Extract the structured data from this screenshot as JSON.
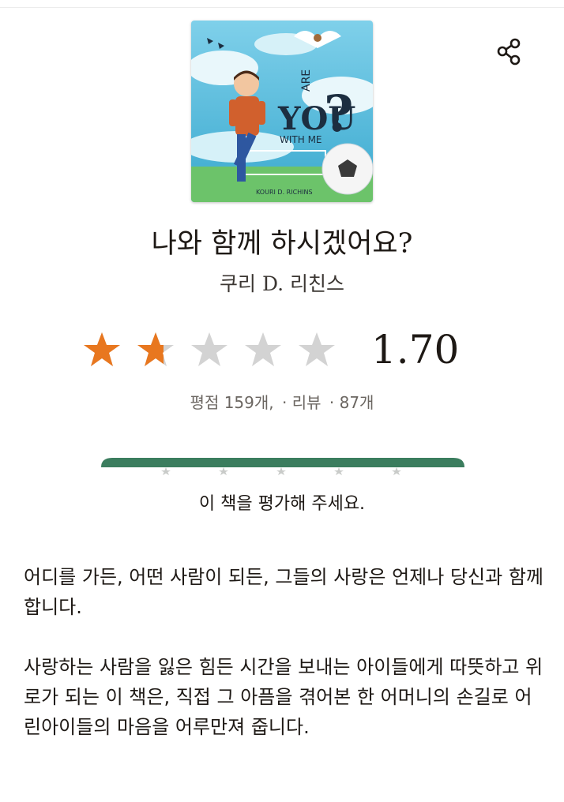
{
  "book": {
    "title": "나와 함께 하시겠어요?",
    "author": "쿠리 D. 리친스",
    "cover": {
      "title_line1": "ARE",
      "title_line2": "YOU",
      "title_line3": "WITH ME",
      "question_mark": "?",
      "author_on_cover": "KOURI D. RICHINS"
    }
  },
  "rating": {
    "value": "1.70",
    "stars_filled": 1.7,
    "stars_total": 5,
    "count_text": "평점 159개,",
    "reviews_label": "· 리뷰",
    "reviews_count": "· 87개",
    "filled_color": "#e8771f",
    "empty_color": "#d3d3d3"
  },
  "rate_prompt": {
    "label": "이 책을 평가해 주세요.",
    "bar_color": "#3b7d5e"
  },
  "description": {
    "paragraphs": [
      "어디를 가든, 어떤 사람이 되든, 그들의 사랑은 언제나 당신과 함께합니다.",
      "사랑하는 사람을 잃은 힘든 시간을 보내는 아이들에게 따뜻하고 위로가 되는 이 책은, 직접 그 아픔을 겪어본 한 어머니의 손길로 어린아이들의 마음을 어루만져 줍니다."
    ]
  },
  "icons": {
    "share": "share-icon",
    "star": "star-icon"
  }
}
